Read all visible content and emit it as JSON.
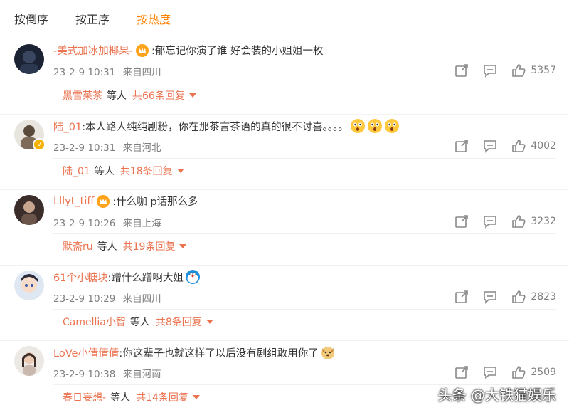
{
  "tabs": [
    "按倒序",
    "按正序",
    "按热度"
  ],
  "active_tab_index": 2,
  "icons": {
    "share": "share-icon",
    "comment": "comment-icon",
    "like": "thumbs-up-icon",
    "crown": "crown-badge-icon",
    "verified": "verified-badge-icon"
  },
  "colors": {
    "accent": "#ff8200",
    "username": "#eb7350",
    "meta": "#808080"
  },
  "comments": [
    {
      "username": "-美式加冰加椰果-",
      "text": ":郁忘记你演了谁 好会装的小姐姐一枚",
      "time": "23-2-9 10:31",
      "location": "来自四川",
      "likes": "5357",
      "reply_user": "黑雪茱茶",
      "reply_mid": "等人",
      "reply_more": "共66条回复"
    },
    {
      "username": "陆_01",
      "text": ":本人路人纯纯剧粉，你在那茶言茶语的真的很不讨喜。。。。",
      "time": "23-2-9 10:31",
      "location": "来自河北",
      "likes": "4002",
      "reply_user": "陆_01",
      "reply_mid": "等人",
      "reply_more": "共18条回复"
    },
    {
      "username": "Lllyt_tiff",
      "text": ":什么咖 p话那么多",
      "time": "23-2-9 10:26",
      "location": "来自上海",
      "likes": "3232",
      "reply_user": "默斋ru",
      "reply_mid": "等人",
      "reply_more": "共19条回复"
    },
    {
      "username": "61个小糖块",
      "text": ":蹭什么蹭啊大姐",
      "time": "23-2-9 10:29",
      "location": "来自四川",
      "likes": "2823",
      "reply_user": "Camellia小智",
      "reply_mid": "等人",
      "reply_more": "共8条回复"
    },
    {
      "username": "LoVe小倩倩倩",
      "text": ":你这辈子也就这样了以后没有剧组敢用你了",
      "time": "23-2-9 10:38",
      "location": "来自河南",
      "likes": "2509",
      "reply_user": "春日妄想-",
      "reply_mid": "等人",
      "reply_more": "共14条回复"
    }
  ],
  "watermark": "头条 @大铁猫娱乐"
}
